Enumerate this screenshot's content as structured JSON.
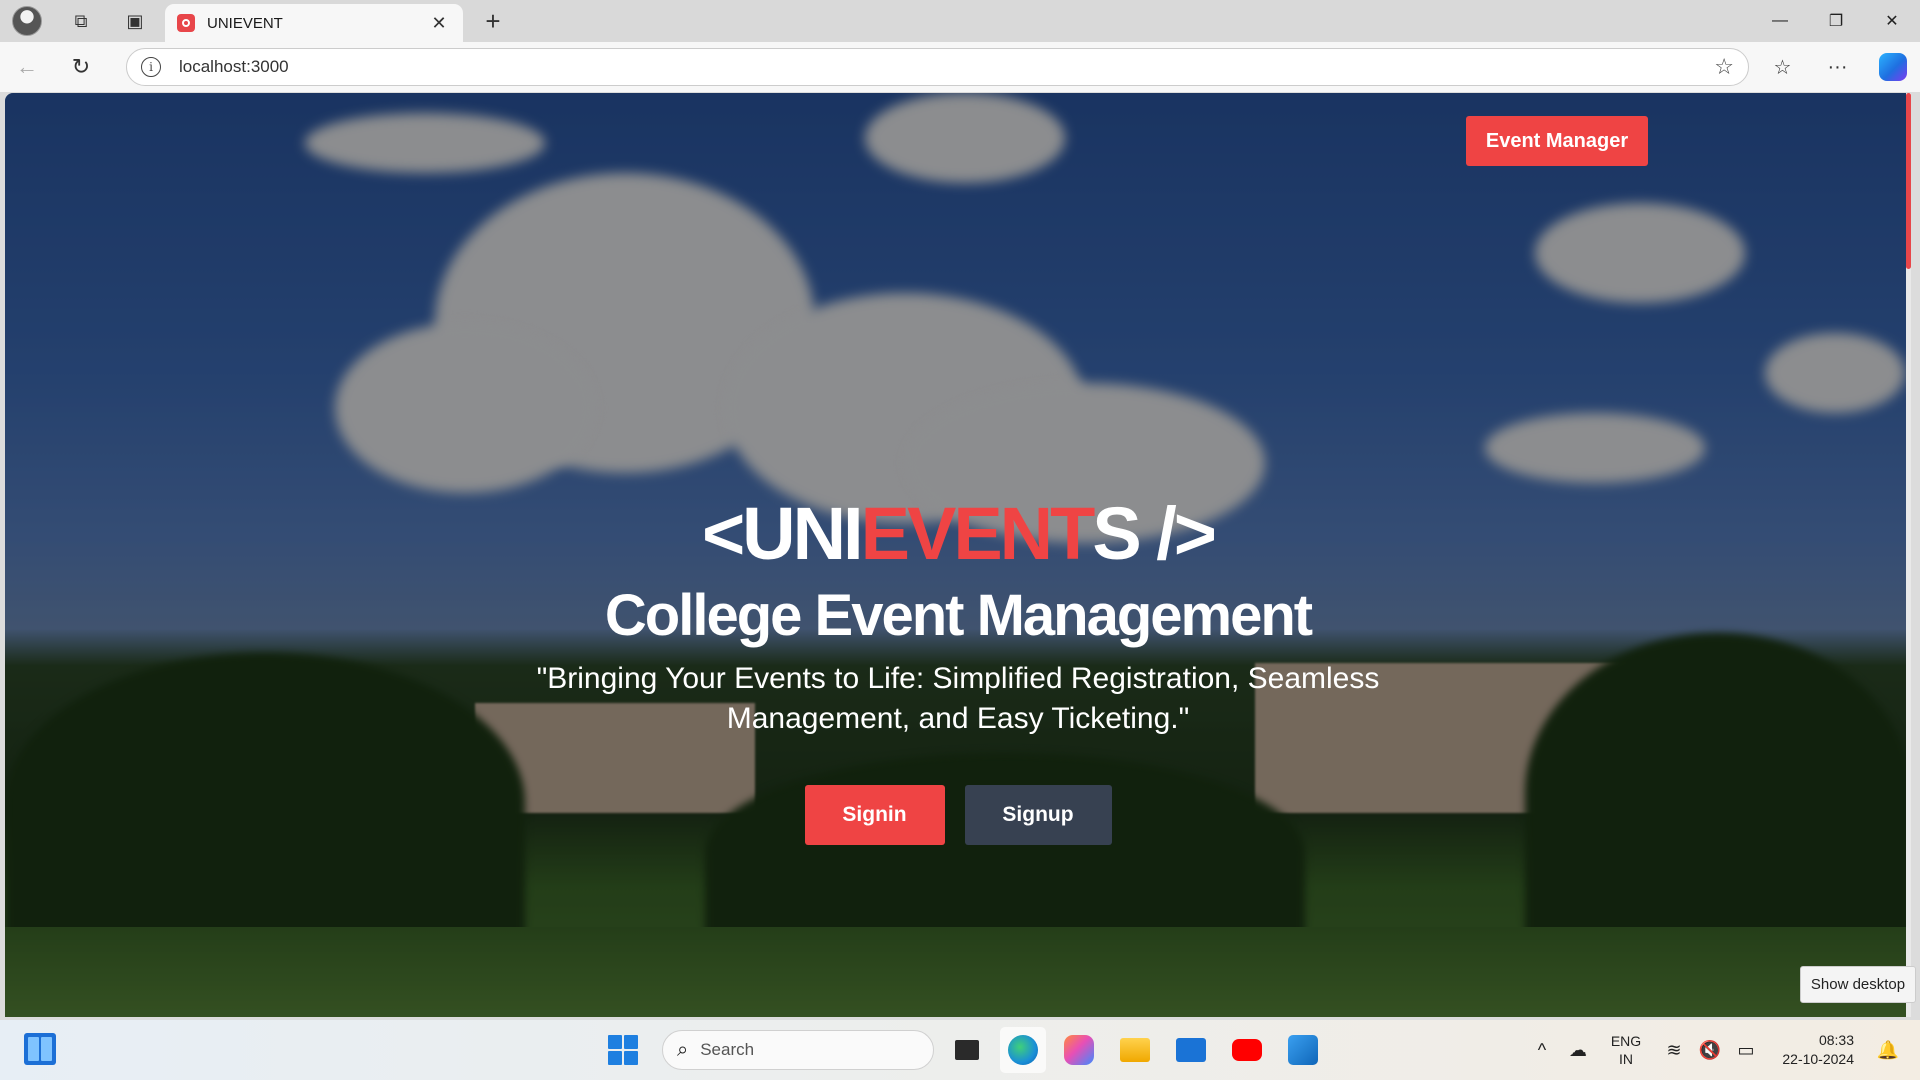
{
  "browser": {
    "tab_title": "UNIEVENT",
    "url": "localhost:3000"
  },
  "page": {
    "nav": {
      "event_manager_label": "Event Manager"
    },
    "logo": {
      "prefix": "<UNI",
      "accent": "EVENT",
      "suffix": "S />"
    },
    "headline": "College Event Management",
    "tagline": "\"Bringing Your Events to Life: Simplified Registration, Seamless Management, and Easy Ticketing.\"",
    "buttons": {
      "signin": "Signin",
      "signup": "Signup"
    },
    "colors": {
      "accent": "#ef4444",
      "secondary": "#374151"
    }
  },
  "tooltip": {
    "show_desktop": "Show desktop"
  },
  "taskbar": {
    "search_placeholder": "Search",
    "apps": [
      "task-view-icon",
      "edge-icon",
      "copilot-icon",
      "file-explorer-icon",
      "mail-icon",
      "youtube-icon",
      "vscode-icon"
    ],
    "lang_line1": "ENG",
    "lang_line2": "IN",
    "time": "08:33",
    "date": "22-10-2024"
  }
}
